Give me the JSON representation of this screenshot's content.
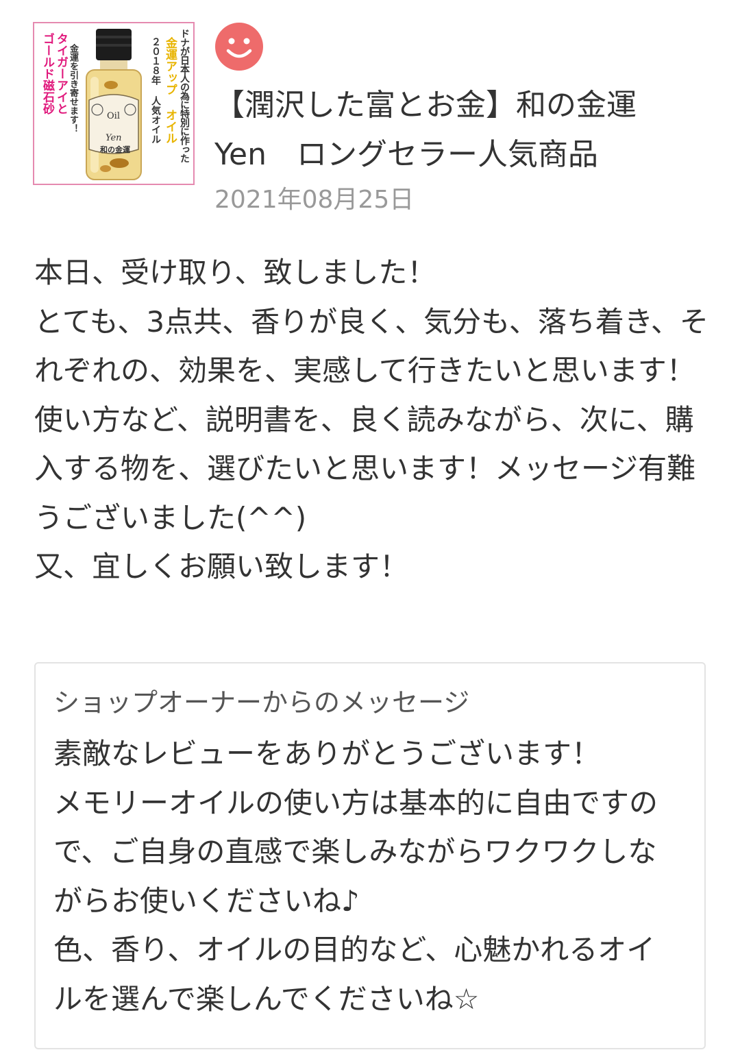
{
  "product": {
    "thumbnail_texts": {
      "line1": "ドナが日本人の為に特別に作った",
      "line2": "金運アップ オイル",
      "line3": "２０１８年 人気オイル",
      "line4": "タイガーアイと",
      "line5": "ゴールド磁石砂",
      "line6": "金運を引き寄せます！",
      "label_oil": "Oil",
      "label_yen": "Yen",
      "label_jp": "和の金運"
    },
    "title": "【潤沢した富とお金】和の金運　Yen　ロングセラー人気商品",
    "date": "2021年08月25日"
  },
  "avatar": {
    "icon": "smiley-face-icon",
    "color": "#ee6b6b"
  },
  "review": {
    "lines": [
      "本日、受け取り、致しました！",
      "とても、3点共、香りが良く、気分も、落ち着き、それぞれの、効果を、実感して行きたいと思います！",
      "使い方など、説明書を、良く読みながら、次に、購入する物を、選びたいと思います！メッセージ有難うございました(^^)",
      "又、宜しくお願い致します！"
    ]
  },
  "owner_reply": {
    "heading": "ショップオーナーからのメッセージ",
    "lines": [
      "素敵なレビューをありがとうございます！",
      "メモリーオイルの使い方は基本的に自由ですので、ご自身の直感で楽しみながらワクワクしながらお使いくださいね♪",
      "色、香り、オイルの目的など、心魅かれるオイルを選んで楽しんでくださいね☆"
    ]
  }
}
